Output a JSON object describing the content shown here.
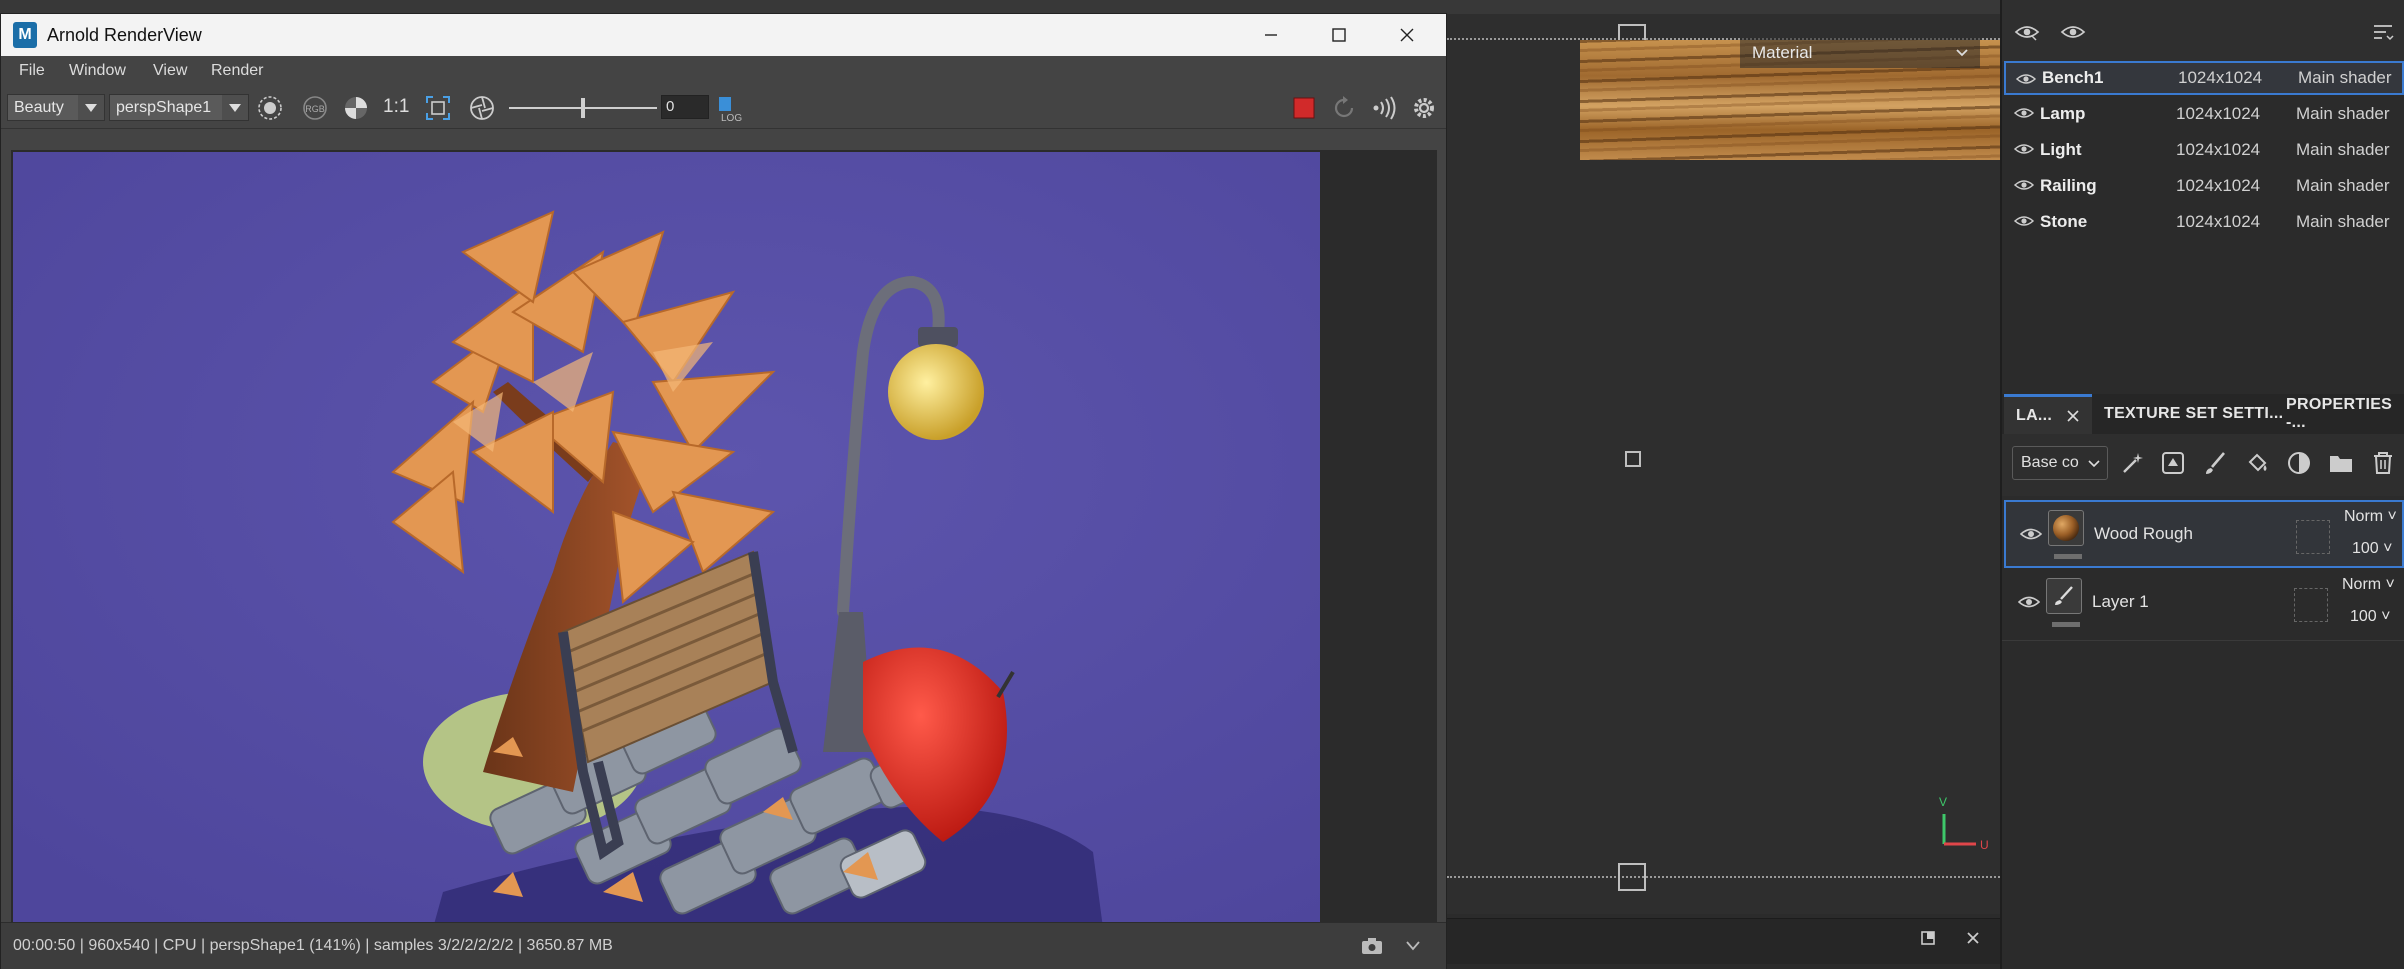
{
  "background_app": {
    "material_dropdown": "Material",
    "uv_axis": {
      "v": "V",
      "u": "U"
    }
  },
  "texture_sets": {
    "rows": [
      {
        "name": "Bench1",
        "resolution": "1024x1024",
        "shader": "Main shader",
        "selected": true
      },
      {
        "name": "Lamp",
        "resolution": "1024x1024",
        "shader": "Main shader"
      },
      {
        "name": "Light",
        "resolution": "1024x1024",
        "shader": "Main shader"
      },
      {
        "name": "Railing",
        "resolution": "1024x1024",
        "shader": "Main shader"
      },
      {
        "name": "Stone",
        "resolution": "1024x1024",
        "shader": "Main shader"
      }
    ]
  },
  "panel_tabs": {
    "layers": "LA...",
    "texture_set_settings": "TEXTURE SET SETTI...",
    "properties": "PROPERTIES -..."
  },
  "layers_toolbar": {
    "channel": "Base co"
  },
  "layers": [
    {
      "name": "Wood Rough",
      "blend": "Norm",
      "opacity": "100",
      "selected": true,
      "icon": "wood-ball-icon"
    },
    {
      "name": "Layer 1",
      "blend": "Norm",
      "opacity": "100",
      "icon": "paint-brush-icon"
    }
  ],
  "arnold": {
    "title": "Arnold RenderView",
    "app_icon_letter": "M",
    "menu": [
      "File",
      "Window",
      "View",
      "Render"
    ],
    "aov": "Beauty",
    "camera": "perspShape1",
    "ratio_label": "1:1",
    "rgb_label": "RGB",
    "log_label": "LOG",
    "frame_value": "0",
    "status": "00:00:50 | 960x540 | CPU | perspShape1 (141%) | samples 3/2/2/2/2/2 | 3650.87 MB",
    "colors": {
      "render_bg": "#574fa4",
      "stop_button": "#d12a2a"
    }
  }
}
